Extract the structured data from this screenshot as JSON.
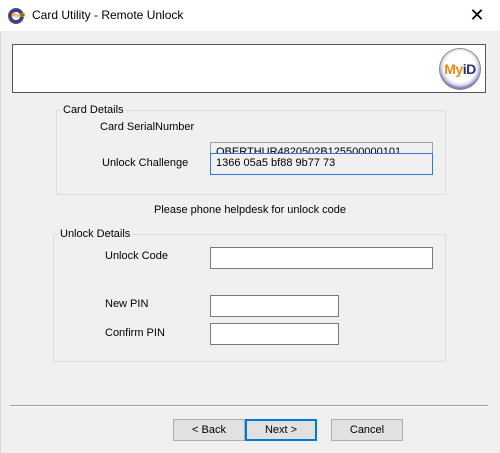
{
  "window": {
    "title": "Card Utility - Remote Unlock",
    "icon": "myid-app-icon",
    "close_glyph": "✕"
  },
  "banner": {
    "logo_text_my": "My",
    "logo_text_id": "iD"
  },
  "card_details": {
    "legend": "Card Details",
    "serial_label": "Card SerialNumber",
    "serial_value": "OBERTHUR4820502B125500000101",
    "challenge_label": "Unlock Challenge",
    "challenge_value": "1366 05a5 bf88 9b77 73"
  },
  "prompt": "Please phone helpdesk for unlock code",
  "unlock_details": {
    "legend": "Unlock Details",
    "code_label": "Unlock Code",
    "code_value": "",
    "new_pin_label": "New PIN",
    "new_pin_value": "",
    "confirm_pin_label": "Confirm PIN",
    "confirm_pin_value": ""
  },
  "buttons": {
    "back": "< Back",
    "next": "Next >",
    "cancel": "Cancel"
  },
  "colors": {
    "window_bg": "#f0f0f0",
    "focus_border": "#2e7ad1",
    "default_button_border": "#0078d7",
    "logo_orange": "#ee8a10",
    "logo_navy": "#2b2b80"
  }
}
